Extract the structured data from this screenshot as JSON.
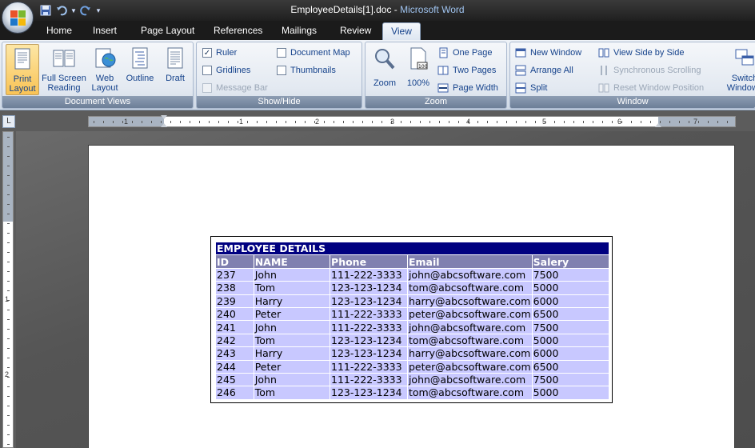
{
  "window": {
    "doc_title": "EmployeeDetails[1].doc",
    "separator": " - ",
    "app_title": "Microsoft Word"
  },
  "tabs": [
    "Home",
    "Insert",
    "Page Layout",
    "References",
    "Mailings",
    "Review",
    "View"
  ],
  "active_tab": "View",
  "ribbon": {
    "document_views": {
      "label": "Document Views",
      "print_layout_1": "Print",
      "print_layout_2": "Layout",
      "full_screen_1": "Full Screen",
      "full_screen_2": "Reading",
      "web_layout_1": "Web",
      "web_layout_2": "Layout",
      "outline": "Outline",
      "draft": "Draft"
    },
    "show_hide": {
      "label": "Show/Hide",
      "ruler": "Ruler",
      "gridlines": "Gridlines",
      "message_bar": "Message Bar",
      "document_map": "Document Map",
      "thumbnails": "Thumbnails"
    },
    "zoom": {
      "label": "Zoom",
      "zoom": "Zoom",
      "percent": "100%",
      "one_page": "One Page",
      "two_pages": "Two Pages",
      "page_width": "Page Width"
    },
    "window": {
      "label": "Window",
      "new_window": "New Window",
      "arrange_all": "Arrange All",
      "split": "Split",
      "view_side_by_side": "View Side by Side",
      "synchronous_scrolling": "Synchronous Scrolling",
      "reset_window_position": "Reset Window Position",
      "switch_1": "Switch",
      "switch_2": "Windows"
    }
  },
  "ruler": {
    "h_numbers": [
      "1",
      "1",
      "2",
      "3",
      "4",
      "5",
      "6",
      "7"
    ],
    "v_numbers": [
      "1",
      "2"
    ]
  },
  "table": {
    "caption": "EMPLOYEE DETAILS",
    "headers": [
      "ID",
      "NAME",
      "Phone",
      "Email",
      "Salery"
    ],
    "rows": [
      [
        "237",
        "John",
        "111-222-3333",
        "john@abcsoftware.com",
        "7500"
      ],
      [
        "238",
        "Tom",
        "123-123-1234",
        "tom@abcsoftware.com",
        "5000"
      ],
      [
        "239",
        "Harry",
        "123-123-1234",
        "harry@abcsoftware.com",
        "6000"
      ],
      [
        "240",
        "Peter",
        "111-222-3333",
        "peter@abcsoftware.com",
        "6500"
      ],
      [
        "241",
        "John",
        "111-222-3333",
        "john@abcsoftware.com",
        "7500"
      ],
      [
        "242",
        "Tom",
        "123-123-1234",
        "tom@abcsoftware.com",
        "5000"
      ],
      [
        "243",
        "Harry",
        "123-123-1234",
        "harry@abcsoftware.com",
        "6000"
      ],
      [
        "244",
        "Peter",
        "111-222-3333",
        "peter@abcsoftware.com",
        "6500"
      ],
      [
        "245",
        "John",
        "111-222-3333",
        "john@abcsoftware.com",
        "7500"
      ],
      [
        "246",
        "Tom",
        "123-123-1234",
        "tom@abcsoftware.com",
        "5000"
      ]
    ]
  },
  "colors": {
    "caption_bg": "#000080",
    "header_bg": "#8080b0",
    "row_bg": "#c8c8ff"
  }
}
